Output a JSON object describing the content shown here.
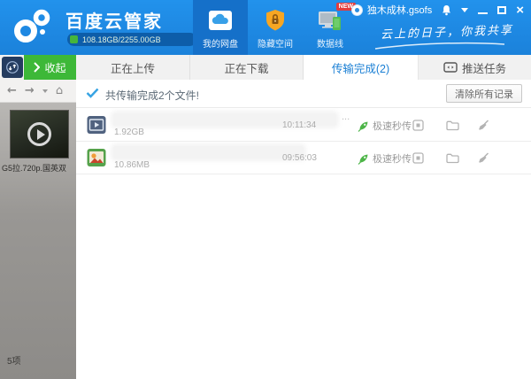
{
  "app": {
    "title": "百度云管家",
    "storage": "108.18GB/2255.00GB",
    "username": "独木成林.gsofs",
    "slogan": "云上的日子，你我共享"
  },
  "nav_tabs": [
    {
      "label": "我的网盘"
    },
    {
      "label": "隐藏空间"
    },
    {
      "label": "数据线",
      "badge": "NEW"
    }
  ],
  "collapse_label": "收起",
  "transfer_tabs": [
    {
      "label": "正在上传"
    },
    {
      "label": "正在下载"
    },
    {
      "label": "传输完成(2)"
    },
    {
      "label": "推送任务"
    }
  ],
  "panel": {
    "summary": "共传输完成2个文件!",
    "clear_button": "清除所有记录",
    "files": [
      {
        "size": "1.92GB",
        "time": "10:11:34",
        "badge": "极速秒传",
        "ellipsis": "..."
      },
      {
        "size": "10.86MB",
        "time": "09:56:03",
        "badge": "极速秒传",
        "ellipsis": ""
      }
    ]
  },
  "sidebar": {
    "back": "←",
    "forward": "→",
    "home": "⌂",
    "caption": "G5拉.720p.国英双",
    "items_count": "5项"
  },
  "colors": {
    "titlebar_blue": "#1d86e0",
    "active_tab_blue": "#1570c9",
    "accent_green": "#3db838",
    "tab_active_text": "#1a7fd4",
    "badge_red": "#e23c3c"
  }
}
